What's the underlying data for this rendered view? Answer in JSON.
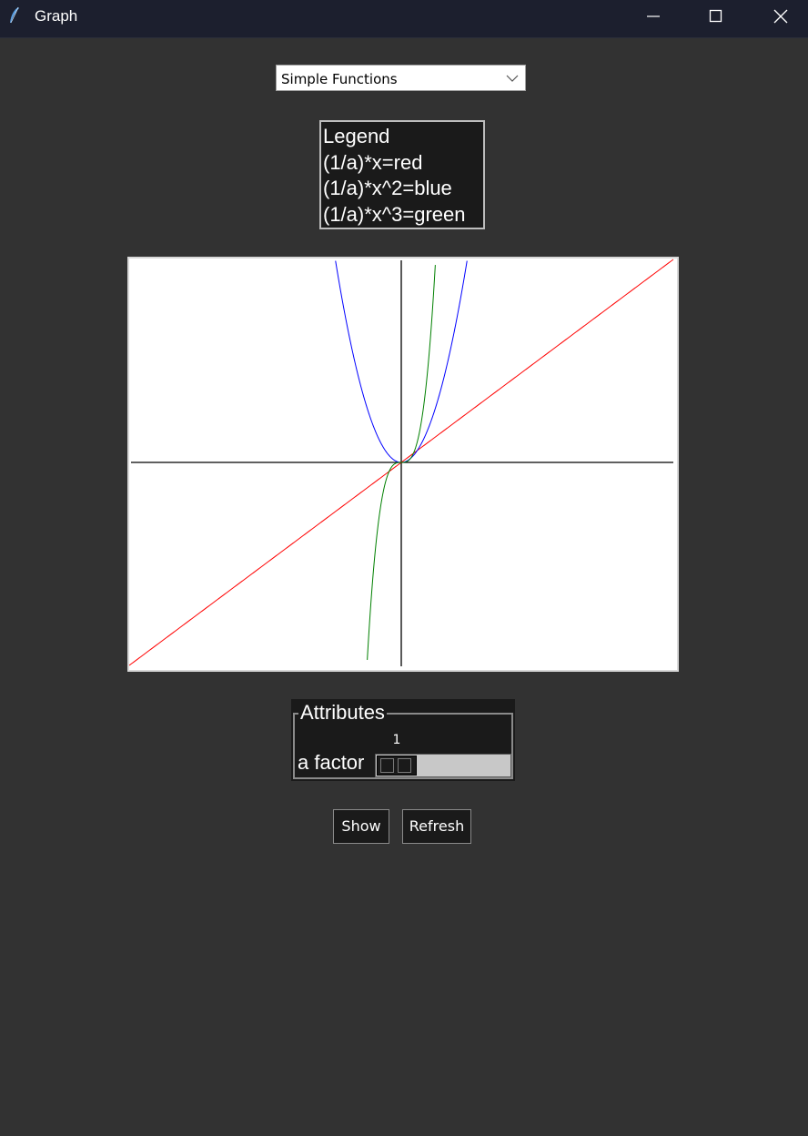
{
  "window": {
    "title": "Graph",
    "icon": "feather-icon"
  },
  "dropdown": {
    "selected": "Simple Functions"
  },
  "legend": {
    "heading": "Legend",
    "items": [
      {
        "label": "(1/a)*x=red",
        "color": "#ff0000"
      },
      {
        "label": "(1/a)*x^2=blue",
        "color": "#0000ff"
      },
      {
        "label": "(1/a)*x^3=green",
        "color": "#008000"
      }
    ]
  },
  "attributes": {
    "title": "Attributes",
    "slider_label": "a factor",
    "slider_value": "1"
  },
  "buttons": {
    "show": "Show",
    "refresh": "Refresh"
  },
  "chart_data": {
    "type": "line",
    "xlim": [
      -300,
      300
    ],
    "ylim": [
      -226,
      226
    ],
    "a": 1,
    "series": [
      {
        "expression": "(1/a)*x",
        "color": "#ff0000",
        "power": 1,
        "scale": 0.75
      },
      {
        "expression": "(1/a)*x^2",
        "color": "#0000ff",
        "power": 2,
        "scale": 0.0425
      },
      {
        "expression": "(1/a)*x^3",
        "color": "#008000",
        "power": 3,
        "scale": 0.00415
      }
    ]
  }
}
